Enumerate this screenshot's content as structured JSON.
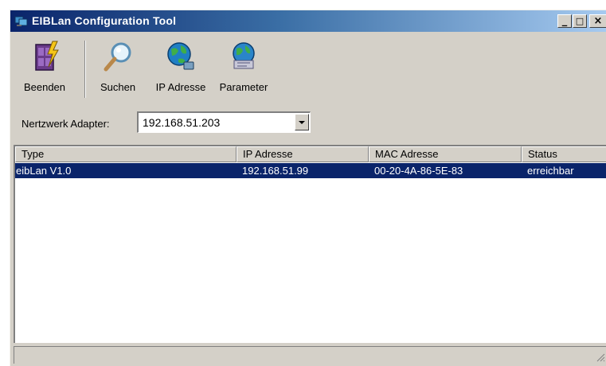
{
  "window": {
    "title": "EIBLan Configuration Tool",
    "controls": {
      "minimize": "_",
      "maximize": "□",
      "close": "×"
    }
  },
  "toolbar": {
    "buttons": [
      {
        "label": "Beenden",
        "icon": "exit-door-icon"
      },
      {
        "label": "Suchen",
        "icon": "magnifier-icon"
      },
      {
        "label": "IP Adresse",
        "icon": "globe-network-icon"
      },
      {
        "label": "Parameter",
        "icon": "globe-settings-icon"
      }
    ]
  },
  "adapter": {
    "label": "Nertzwerk Adapter:",
    "selected": "192.168.51.203"
  },
  "table": {
    "columns": [
      "Type",
      "IP Adresse",
      "MAC Adresse",
      "Status"
    ],
    "rows": [
      {
        "type": "eibLan V1.0",
        "ip": "192.168.51.99",
        "mac": "00-20-4A-86-5E-83",
        "status": "erreichbar",
        "selected": true
      }
    ]
  },
  "colors": {
    "selection": "#0a246a",
    "titlebar_start": "#0a246a",
    "titlebar_end": "#a6caf0",
    "face": "#d4d0c8"
  }
}
